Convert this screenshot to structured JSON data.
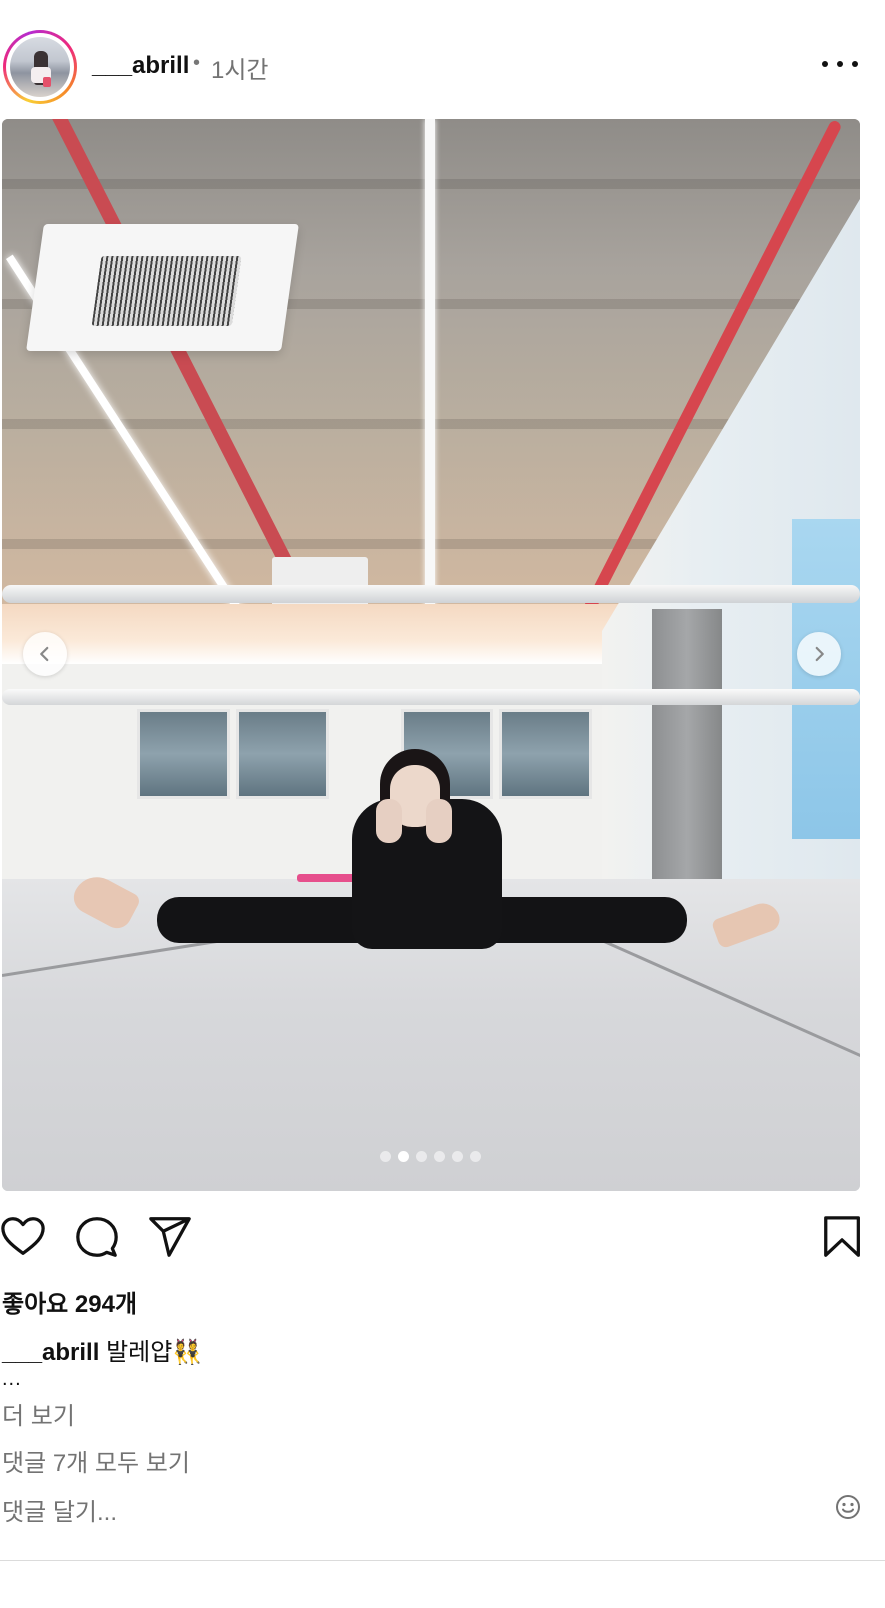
{
  "post": {
    "username": "___abrill",
    "separator": "•",
    "time": "1시간",
    "more_icon": "more-horizontal-icon"
  },
  "media": {
    "current_index": 2,
    "total": 6,
    "prev_icon": "chevron-left-icon",
    "next_icon": "chevron-right-icon"
  },
  "actions": {
    "like_icon": "heart-icon",
    "comment_icon": "comment-bubble-icon",
    "share_icon": "paper-plane-icon",
    "save_icon": "bookmark-icon"
  },
  "likes": "좋아요 294개",
  "caption": {
    "username": "___abrill",
    "text": "발레얍👯",
    "ellipsis": "...",
    "more_label": "더 보기"
  },
  "comments": {
    "view_all_label": "댓글 7개 모두 보기",
    "add_placeholder": "댓글 달기...",
    "emoji_icon": "smiley-icon"
  },
  "colors": {
    "text": "#000000",
    "secondary": "#737373",
    "divider": "#dbdbdb",
    "story_ring": "#ee2a7b"
  }
}
